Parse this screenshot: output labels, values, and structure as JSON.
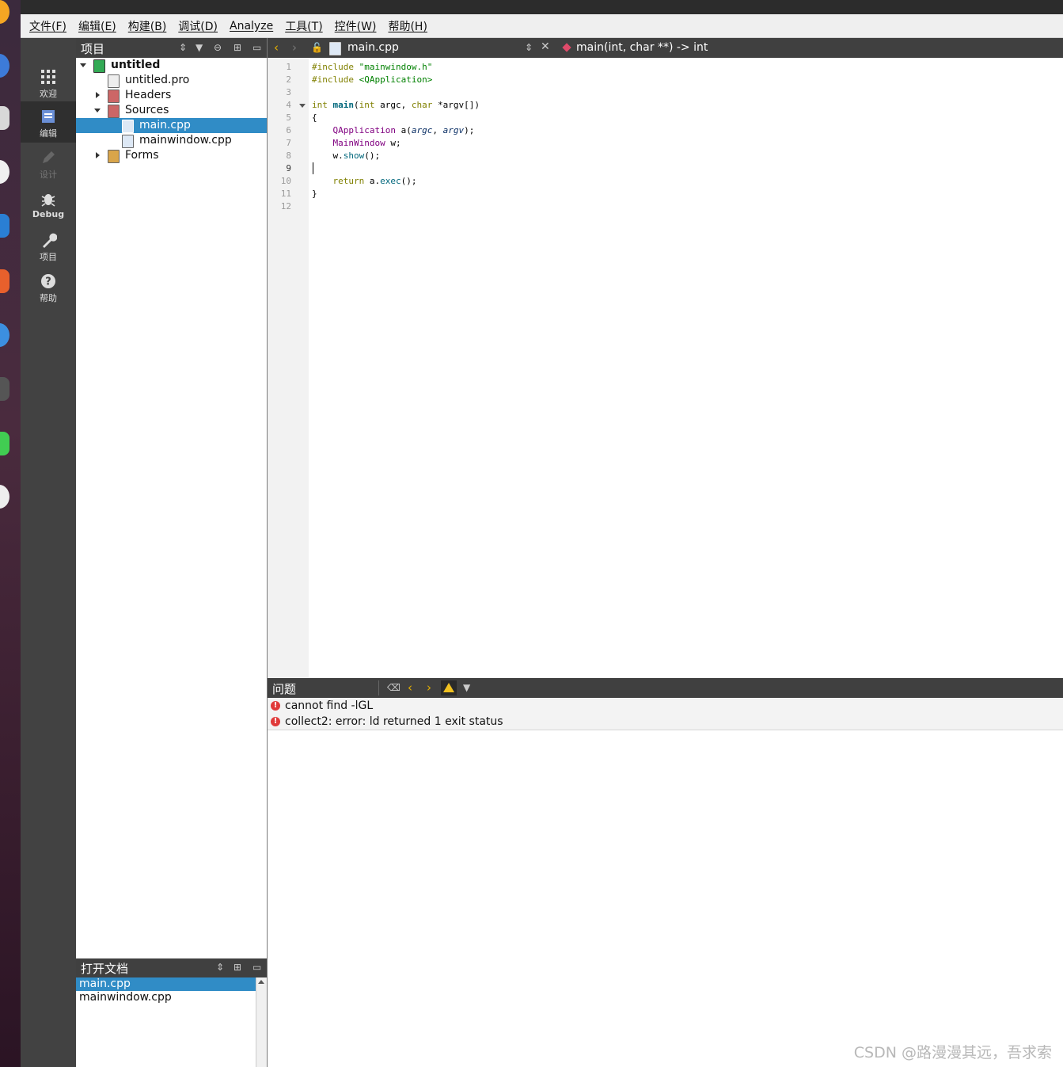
{
  "menubar": {
    "items": [
      "文件(F)",
      "编辑(E)",
      "构建(B)",
      "调试(D)",
      "Analyze",
      "工具(T)",
      "控件(W)",
      "帮助(H)"
    ]
  },
  "modes": [
    {
      "label": "欢迎",
      "icon": "grid-icon",
      "state": "normal"
    },
    {
      "label": "编辑",
      "icon": "edit-icon",
      "state": "active"
    },
    {
      "label": "设计",
      "icon": "pencil-icon",
      "state": "disabled"
    },
    {
      "label": "Debug",
      "icon": "bug-icon",
      "state": "normal"
    },
    {
      "label": "项目",
      "icon": "wrench-icon",
      "state": "normal"
    },
    {
      "label": "帮助",
      "icon": "help-icon",
      "state": "normal"
    }
  ],
  "project_panel": {
    "title": "项目",
    "tree": [
      {
        "label": "untitled",
        "level": 0,
        "expanded": true,
        "bold": true
      },
      {
        "label": "untitled.pro",
        "level": 1
      },
      {
        "label": "Headers",
        "level": 1,
        "expanded": false
      },
      {
        "label": "Sources",
        "level": 1,
        "expanded": true
      },
      {
        "label": "main.cpp",
        "level": 2,
        "selected": true
      },
      {
        "label": "mainwindow.cpp",
        "level": 2
      },
      {
        "label": "Forms",
        "level": 1,
        "expanded": false
      }
    ]
  },
  "open_docs": {
    "title": "打开文档",
    "items": [
      "main.cpp",
      "mainwindow.cpp"
    ],
    "selected_index": 0
  },
  "editor": {
    "file_name": "main.cpp",
    "symbol": "main(int, char **) -> int",
    "current_line": 9,
    "line_numbers": [
      "1",
      "2",
      "3",
      "4",
      "5",
      "6",
      "7",
      "8",
      "9",
      "10",
      "11",
      "12"
    ]
  },
  "issues": {
    "title": "问题",
    "items": [
      "cannot find -lGL",
      "collect2: error: ld returned 1 exit status"
    ]
  },
  "watermark": "CSDN @路漫漫其远，吾求索",
  "colors": {
    "selection": "#308cc6",
    "panel_header": "#404040",
    "error": "#e03a3a"
  }
}
